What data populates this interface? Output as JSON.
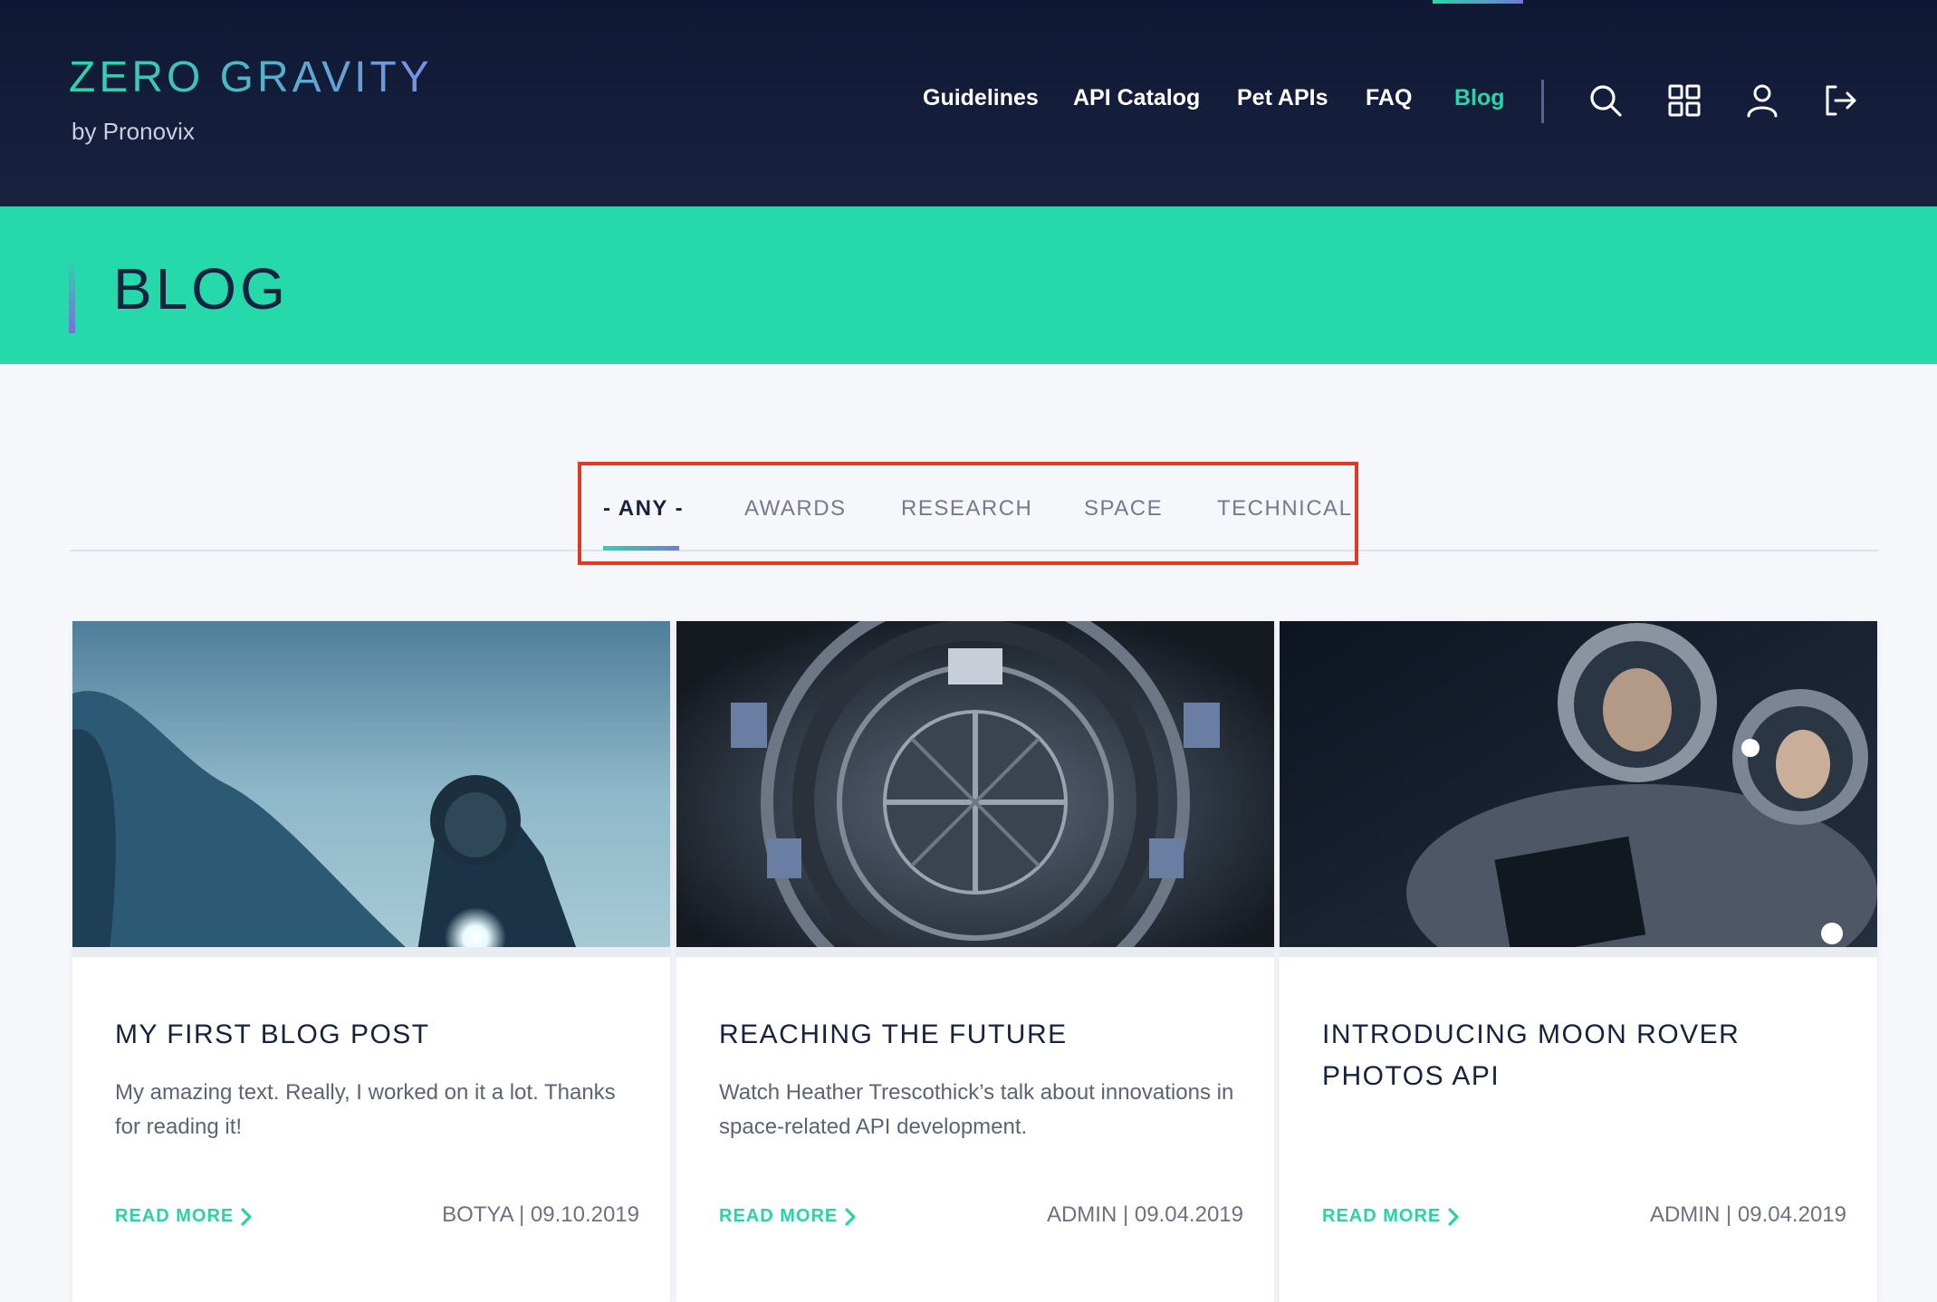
{
  "header": {
    "logo": "ZERO GRAVITY",
    "logo_sub": "by Pronovix",
    "nav": [
      {
        "label": "Guidelines"
      },
      {
        "label": "API Catalog"
      },
      {
        "label": "Pet APIs"
      },
      {
        "label": "FAQ"
      },
      {
        "label": "Blog",
        "active": true
      }
    ],
    "icons": [
      "search-icon",
      "grid-icon",
      "user-icon",
      "logout-icon"
    ]
  },
  "banner": {
    "title": "BLOG"
  },
  "filters": {
    "tabs": [
      {
        "label": "- ANY -",
        "active": true
      },
      {
        "label": "AWARDS"
      },
      {
        "label": "RESEARCH"
      },
      {
        "label": "SPACE"
      },
      {
        "label": "TECHNICAL"
      }
    ]
  },
  "posts": [
    {
      "title": "MY FIRST BLOG POST",
      "excerpt": "My amazing text. Really, I worked on it a lot. Thanks for reading it!",
      "read_more": "READ MORE",
      "meta": "BOTYA | 09.10.2019"
    },
    {
      "title": "REACHING THE FUTURE",
      "excerpt": "Watch Heather Trescothick’s talk about innovations in space-related API development.",
      "read_more": "READ MORE",
      "meta": "ADMIN | 09.04.2019"
    },
    {
      "title": "INTRODUCING MOON ROVER PHOTOS API",
      "excerpt": "",
      "read_more": "READ MORE",
      "meta": "ADMIN | 09.04.2019"
    }
  ],
  "colors": {
    "header_bg": "#131c38",
    "accent": "#26d9ab",
    "highlight_box": "#e03a24",
    "title_text": "#16223f"
  }
}
